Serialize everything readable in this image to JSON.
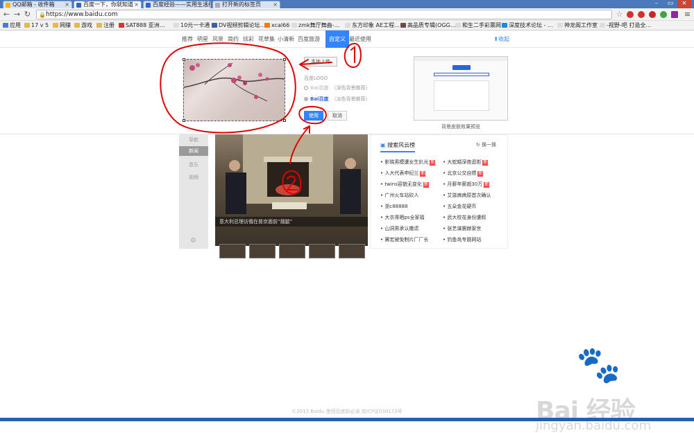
{
  "tabs": [
    {
      "label": "QQ邮箱 - 收件箱",
      "active": false
    },
    {
      "label": "百度一下，你就知道",
      "active": true
    },
    {
      "label": "百度经验——实用生活指南",
      "active": false
    },
    {
      "label": "打开新的标签页",
      "active": false
    }
  ],
  "address": {
    "url": "https://www.baidu.com"
  },
  "bookmarks": [
    "应用",
    "17 v 5",
    "网赚",
    "游戏",
    "注册",
    "SAT888 亚洲…",
    "10元一卡通",
    "DV视频剪辑论坛…",
    "xcal66",
    "zmk舞厅舞曲-…",
    "东方印象 AE工程…",
    "高品质专辑(OGG…",
    "和生二手彩票网",
    "深度技术论坛 - …",
    "神龙阁工作室",
    "-视野-吧 打造全…"
  ],
  "skin_nav": {
    "tabs": [
      "推荐",
      "明星",
      "风景",
      "简约",
      "炫彩",
      "花草集",
      "小清新",
      "百度旅游",
      "自定义",
      "最近使用"
    ],
    "selected": "自定义",
    "favorite_label": "收起"
  },
  "editor": {
    "upload_label": "本地上传",
    "logo_label": "百度LOGO",
    "logo_options": [
      {
        "logo": "Bai百度",
        "hint": "（深色背景推荐）",
        "selected": false
      },
      {
        "logo": "Bai百度",
        "hint": "（淡色背景推荐）",
        "selected": true
      }
    ],
    "use_label": "使用",
    "cancel_label": "取消",
    "preview_caption": "背景皮肤效果预览"
  },
  "left_nav": [
    "导航",
    "新闻",
    "音乐",
    "视频"
  ],
  "left_nav_selected": "新闻",
  "news": {
    "caption": "意大利总理访俄在普京面前“翘腿”"
  },
  "hot": {
    "title": "搜索风云榜",
    "refresh_label": "换一换",
    "left": [
      {
        "text": "影晓男模遭女生扒光",
        "badge": "新"
      },
      {
        "text": "人大代表申纪兰",
        "badge": "新"
      },
      {
        "text": "twins容貌无变化",
        "badge": "新"
      },
      {
        "text": "广州火车站砍人",
        "badge": ""
      },
      {
        "text": "浙c88888",
        "badge": ""
      },
      {
        "text": "大衣哥晒ps全家福",
        "badge": ""
      },
      {
        "text": "山洞男承认撒谎",
        "badge": ""
      },
      {
        "text": "冀宏被免制片厂厂长",
        "badge": ""
      }
    ],
    "right": [
      {
        "text": "大蛇婚深夜逛街",
        "badge": "新"
      },
      {
        "text": "北京公交自燃",
        "badge": "新"
      },
      {
        "text": "月薪年薪超30万",
        "badge": "新"
      },
      {
        "text": "艾滋病病原首次确认",
        "badge": ""
      },
      {
        "text": "五朵金花硬币",
        "badge": ""
      },
      {
        "text": "武大校花身份遭假",
        "badge": ""
      },
      {
        "text": "张艺谋罢赫家世",
        "badge": ""
      },
      {
        "text": "钓鱼岛专题网站",
        "badge": ""
      }
    ]
  },
  "footer": "©2015 Baidu 使用百度前必读 京ICP证030173号",
  "watermark": {
    "logo": "Bai 经验",
    "url": "jingyan.baidu.com"
  },
  "annotation_labels": [
    "1",
    "2"
  ],
  "colors": {
    "accent": "#3385ff",
    "badge": "#f54545",
    "pen": "#e00000"
  }
}
